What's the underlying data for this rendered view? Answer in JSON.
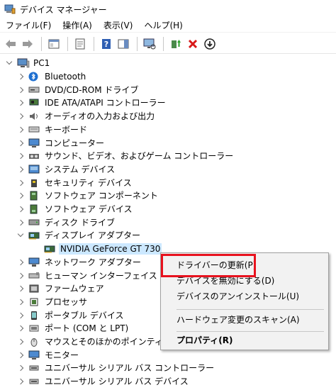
{
  "window": {
    "title": "デバイス マネージャー"
  },
  "menu": [
    "ファイル(F)",
    "操作(A)",
    "表示(V)",
    "ヘルプ(H)"
  ],
  "tree": {
    "root": "PC1",
    "categories": [
      {
        "label": "Bluetooth",
        "icon": "bluetooth-icon",
        "expanded": false
      },
      {
        "label": "DVD/CD-ROM ドライブ",
        "icon": "dvd-drive-icon",
        "expanded": false
      },
      {
        "label": "IDE ATA/ATAPI コントローラー",
        "icon": "ide-controller-icon",
        "expanded": false
      },
      {
        "label": "オーディオの入力および出力",
        "icon": "audio-icon",
        "expanded": false
      },
      {
        "label": "キーボード",
        "icon": "keyboard-icon",
        "expanded": false
      },
      {
        "label": "コンピューター",
        "icon": "computer-icon",
        "expanded": false
      },
      {
        "label": "サウンド、ビデオ、およびゲーム コントローラー",
        "icon": "sound-icon",
        "expanded": false
      },
      {
        "label": "システム デバイス",
        "icon": "system-device-icon",
        "expanded": false
      },
      {
        "label": "セキュリティ デバイス",
        "icon": "security-device-icon",
        "expanded": false
      },
      {
        "label": "ソフトウェア コンポーネント",
        "icon": "software-component-icon",
        "expanded": false
      },
      {
        "label": "ソフトウェア デバイス",
        "icon": "software-device-icon",
        "expanded": false
      },
      {
        "label": "ディスク ドライブ",
        "icon": "disk-drive-icon",
        "expanded": false
      },
      {
        "label": "ディスプレイ アダプター",
        "icon": "display-adapter-icon",
        "expanded": true
      },
      {
        "label": "NVIDIA GeForce GT 730",
        "icon": "display-adapter-icon",
        "child": true,
        "selected": true
      },
      {
        "label": "ネットワーク アダプター",
        "icon": "network-adapter-icon",
        "expanded": false
      },
      {
        "label": "ヒューマン インターフェイス デバイ",
        "icon": "hid-icon",
        "expanded": false
      },
      {
        "label": "ファームウェア",
        "icon": "firmware-icon",
        "expanded": false
      },
      {
        "label": "プロセッサ",
        "icon": "processor-icon",
        "expanded": false
      },
      {
        "label": "ポータブル デバイス",
        "icon": "portable-device-icon",
        "expanded": false
      },
      {
        "label": "ポート (COM と LPT)",
        "icon": "port-icon",
        "expanded": false
      },
      {
        "label": "マウスとそのほかのポインティン",
        "icon": "mouse-icon",
        "expanded": false
      },
      {
        "label": "モニター",
        "icon": "monitor-icon",
        "expanded": false
      },
      {
        "label": "ユニバーサル シリアル バス コントローラー",
        "icon": "usb-controller-icon",
        "expanded": false
      },
      {
        "label": "ユニバーサル シリアル バス デバイス",
        "icon": "usb-device-icon",
        "expanded": false
      }
    ]
  },
  "context_menu": {
    "update_driver": "ドライバーの更新(P)",
    "disable_device": "デバイスを無効にする(D)",
    "uninstall_device": "デバイスのアンインストール(U)",
    "scan_hardware": "ハードウェア変更のスキャン(A)",
    "properties": "プロパティ(R)"
  },
  "colors": {
    "highlight": "#e8121e",
    "selection": "#cce8ff"
  }
}
